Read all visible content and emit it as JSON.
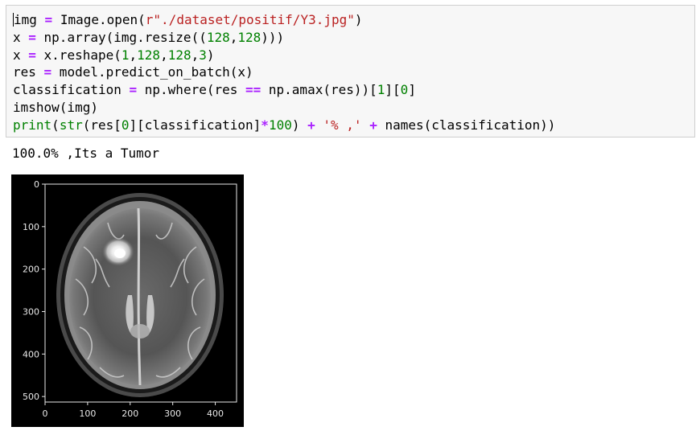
{
  "code_cell": {
    "lines": [
      [
        {
          "t": "img",
          "c": ""
        },
        {
          "t": " ",
          "c": ""
        },
        {
          "t": "=",
          "c": "op"
        },
        {
          "t": " Image.open(",
          "c": ""
        },
        {
          "t": "r\"./dataset/positif/Y3.jpg\"",
          "c": "str"
        },
        {
          "t": ")",
          "c": ""
        }
      ],
      [
        {
          "t": "x ",
          "c": ""
        },
        {
          "t": "=",
          "c": "op"
        },
        {
          "t": " np.array(img.resize((",
          "c": ""
        },
        {
          "t": "128",
          "c": "num"
        },
        {
          "t": ",",
          "c": ""
        },
        {
          "t": "128",
          "c": "num"
        },
        {
          "t": ")))",
          "c": ""
        }
      ],
      [
        {
          "t": "x ",
          "c": ""
        },
        {
          "t": "=",
          "c": "op"
        },
        {
          "t": " x.reshape(",
          "c": ""
        },
        {
          "t": "1",
          "c": "num"
        },
        {
          "t": ",",
          "c": ""
        },
        {
          "t": "128",
          "c": "num"
        },
        {
          "t": ",",
          "c": ""
        },
        {
          "t": "128",
          "c": "num"
        },
        {
          "t": ",",
          "c": ""
        },
        {
          "t": "3",
          "c": "num"
        },
        {
          "t": ")",
          "c": ""
        }
      ],
      [
        {
          "t": "res ",
          "c": ""
        },
        {
          "t": "=",
          "c": "op"
        },
        {
          "t": " model.predict_on_batch(x)",
          "c": ""
        }
      ],
      [
        {
          "t": "classification ",
          "c": ""
        },
        {
          "t": "=",
          "c": "op"
        },
        {
          "t": " np.where(res ",
          "c": ""
        },
        {
          "t": "==",
          "c": "op"
        },
        {
          "t": " np.amax(res))[",
          "c": ""
        },
        {
          "t": "1",
          "c": "num"
        },
        {
          "t": "][",
          "c": ""
        },
        {
          "t": "0",
          "c": "num"
        },
        {
          "t": "]",
          "c": ""
        }
      ],
      [
        {
          "t": "imshow(img)",
          "c": ""
        }
      ],
      [
        {
          "t": "print",
          "c": "kw"
        },
        {
          "t": "(",
          "c": ""
        },
        {
          "t": "str",
          "c": "kw"
        },
        {
          "t": "(res[",
          "c": ""
        },
        {
          "t": "0",
          "c": "num"
        },
        {
          "t": "][classification]",
          "c": ""
        },
        {
          "t": "*",
          "c": "op"
        },
        {
          "t": "100",
          "c": "num"
        },
        {
          "t": ") ",
          "c": ""
        },
        {
          "t": "+",
          "c": "op"
        },
        {
          "t": " ",
          "c": ""
        },
        {
          "t": "'% ,'",
          "c": "str"
        },
        {
          "t": " ",
          "c": ""
        },
        {
          "t": "+",
          "c": "op"
        },
        {
          "t": " names(classification))",
          "c": ""
        }
      ]
    ]
  },
  "output": {
    "text": "100.0% ,Its a Tumor"
  },
  "figure": {
    "x_ticks": [
      "0",
      "100",
      "200",
      "300",
      "400"
    ],
    "y_ticks": [
      "0",
      "100",
      "200",
      "300",
      "400",
      "500"
    ],
    "x_tick_values": [
      0,
      100,
      200,
      300,
      400
    ],
    "y_tick_values": [
      0,
      100,
      200,
      300,
      400,
      500
    ],
    "image_width": 450,
    "image_height": 513,
    "image_description_icon": "brain-mri-scan"
  }
}
